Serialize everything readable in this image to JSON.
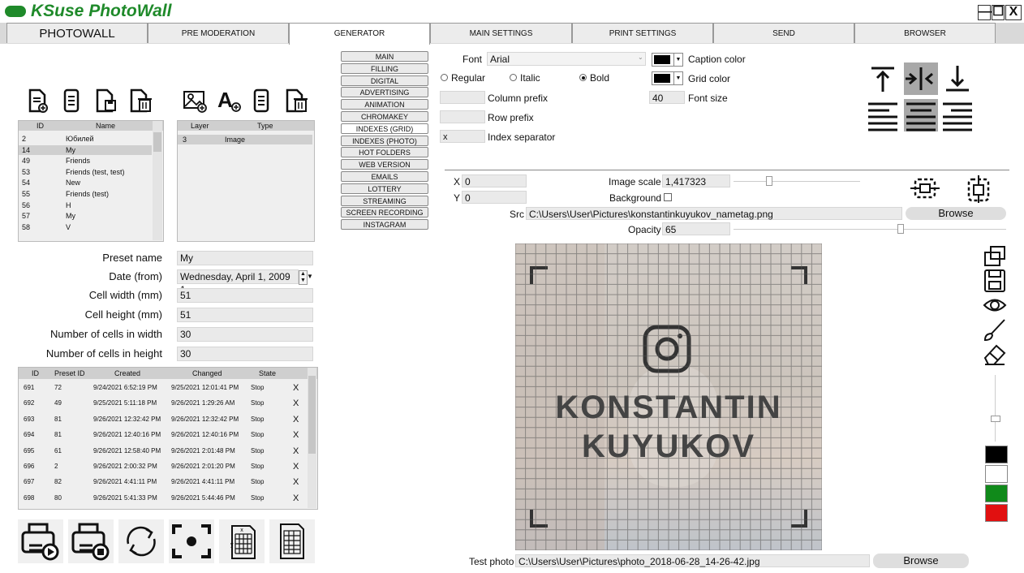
{
  "app": {
    "title": "KSuse PhotoWall"
  },
  "window_buttons": [
    "—",
    "☐",
    "X"
  ],
  "tabs": [
    "PHOTOWALL",
    "PRE MODERATION",
    "GENERATOR",
    "MAIN SETTINGS",
    "PRINT SETTINGS",
    "SEND",
    "BROWSER"
  ],
  "presets": {
    "columns": [
      "ID",
      "Name"
    ],
    "rows": [
      {
        "id": "2",
        "name": "Юбилей"
      },
      {
        "id": "14",
        "name": "My"
      },
      {
        "id": "49",
        "name": "Friends"
      },
      {
        "id": "53",
        "name": "Friends (test, test)"
      },
      {
        "id": "54",
        "name": "New"
      },
      {
        "id": "55",
        "name": "Friends (test)"
      },
      {
        "id": "56",
        "name": "H"
      },
      {
        "id": "57",
        "name": "My"
      },
      {
        "id": "58",
        "name": "V"
      }
    ]
  },
  "layers": {
    "columns": [
      "Layer",
      "Type"
    ],
    "rows": [
      {
        "layer": "3",
        "type": "Image"
      }
    ]
  },
  "form": {
    "preset_name_label": "Preset name",
    "preset_name": "My",
    "date_label": "Date (from)",
    "date": "Wednesday, April 1, 2009 1",
    "cell_width_label": "Cell width (mm)",
    "cell_width": "51",
    "cell_height_label": "Cell height (mm)",
    "cell_height": "51",
    "cells_width_label": "Number of cells in width",
    "cells_width": "30",
    "cells_height_label": "Number of cells in height",
    "cells_height": "30"
  },
  "jobs": {
    "columns": [
      "ID",
      "Preset ID",
      "Created",
      "Changed",
      "State"
    ],
    "rows": [
      {
        "id": "691",
        "preset": "72",
        "created": "9/24/2021 6:52:19 PM",
        "changed": "9/25/2021 12:01:41 PM",
        "state": "Stop"
      },
      {
        "id": "692",
        "preset": "49",
        "created": "9/25/2021 5:11:18 PM",
        "changed": "9/26/2021 1:29:26 AM",
        "state": "Stop"
      },
      {
        "id": "693",
        "preset": "81",
        "created": "9/26/2021 12:32:42 PM",
        "changed": "9/26/2021 12:32:42 PM",
        "state": "Stop"
      },
      {
        "id": "694",
        "preset": "81",
        "created": "9/26/2021 12:40:16 PM",
        "changed": "9/26/2021 12:40:16 PM",
        "state": "Stop"
      },
      {
        "id": "695",
        "preset": "61",
        "created": "9/26/2021 12:58:40 PM",
        "changed": "9/26/2021 2:01:48 PM",
        "state": "Stop"
      },
      {
        "id": "696",
        "preset": "2",
        "created": "9/26/2021 2:00:32 PM",
        "changed": "9/26/2021 2:01:20 PM",
        "state": "Stop"
      },
      {
        "id": "697",
        "preset": "82",
        "created": "9/26/2021 4:41:11 PM",
        "changed": "9/26/2021 4:41:11 PM",
        "state": "Stop"
      },
      {
        "id": "698",
        "preset": "80",
        "created": "9/26/2021 5:41:33 PM",
        "changed": "9/26/2021 5:44:46 PM",
        "state": "Stop"
      }
    ],
    "delete_glyph": "X"
  },
  "generator_tabs": [
    "MAIN",
    "FILLING",
    "DIGITAL",
    "ADVERTISING",
    "ANIMATION",
    "CHROMAKEY",
    "INDEXES (GRID)",
    "INDEXES (PHOTO)",
    "HOT FOLDERS",
    "WEB VERSION",
    "EMAILS",
    "LOTTERY",
    "STREAMING",
    "SCREEN RECORDING",
    "INSTAGRAM"
  ],
  "grid": {
    "font_label": "Font",
    "font_value": "Arial",
    "caption_color_label": "Caption color",
    "grid_color_label": "Grid color",
    "regular_label": "Regular",
    "italic_label": "Italic",
    "bold_label": "Bold",
    "style_selected": "Bold",
    "column_prefix_label": "Column prefix",
    "column_prefix": "",
    "row_prefix_label": "Row prefix",
    "row_prefix": "",
    "index_separator_label": "Index separator",
    "index_separator": "x",
    "font_size_label": "Font size",
    "font_size": "40",
    "caption_color": "#000000",
    "grid_color": "#000000"
  },
  "image": {
    "x_label": "X",
    "x": "0",
    "y_label": "Y",
    "y": "0",
    "scale_label": "Image scale",
    "scale": "1,417323",
    "background_label": "Background",
    "src_label": "Src",
    "src": "C:\\Users\\User\\Pictures\\konstantinkuyukov_nametag.png",
    "browse_label": "Browse",
    "opacity_label": "Opacity",
    "opacity": "65",
    "scale_slider_fraction": 0.78,
    "opacity_slider_fraction": 0.6
  },
  "preview": {
    "name_line1": "KONSTANTIN",
    "name_line2": "KUYUKOV",
    "grid_cells": 30
  },
  "test_photo": {
    "label": "Test photo",
    "path": "C:\\Users\\User\\Pictures\\photo_2018-06-28_14-26-42.jpg",
    "browse_label": "Browse"
  },
  "palette_colors": [
    "#000000",
    "#ffffff",
    "#108a1a",
    "#e11010"
  ],
  "icons": [
    "add-preset-icon",
    "copy-preset-icon",
    "save-preset-icon",
    "delete-preset-icon",
    "add-image-layer-icon",
    "add-text-layer-icon",
    "copy-layer-icon",
    "delete-layer-icon",
    "print-play-icon",
    "print-stop-icon",
    "refresh-icon",
    "screenshot-icon",
    "grid-xy-icon",
    "grid-table-icon",
    "align-top-icon",
    "align-vcenter-icon",
    "align-bottom-icon",
    "align-left-icon",
    "align-center-icon",
    "align-right-icon",
    "center-horizontal-icon",
    "center-vertical-icon",
    "crop-icon",
    "save-icon",
    "eye-icon",
    "brush-icon",
    "eraser-icon"
  ]
}
